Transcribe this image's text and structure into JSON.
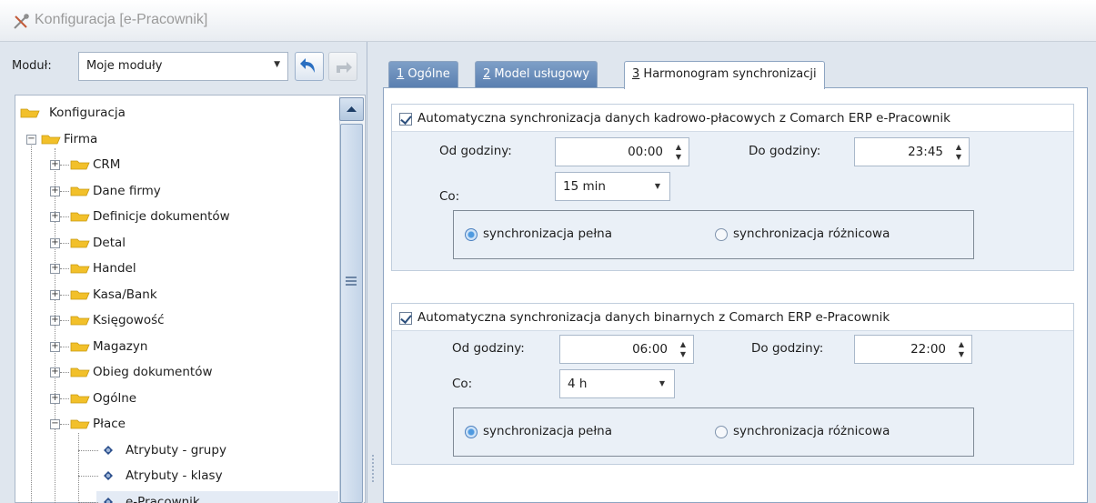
{
  "window": {
    "title": "Konfiguracja [e-Pracownik]"
  },
  "module": {
    "label": "Moduł:",
    "value": "Moje moduły"
  },
  "tree": {
    "root": "Konfiguracja",
    "firma": "Firma",
    "children": [
      "CRM",
      "Dane firmy",
      "Definicje dokumentów",
      "Detal",
      "Handel",
      "Kasa/Bank",
      "Księgowość",
      "Magazyn",
      "Obieg dokumentów",
      "Ogólne",
      "Płace"
    ],
    "place_children": [
      "Atrybuty - grupy",
      "Atrybuty - klasy",
      "e-Pracownik"
    ]
  },
  "tabs": [
    {
      "num": "1",
      "label": "Ogólne"
    },
    {
      "num": "2",
      "label": "Model usługowy"
    },
    {
      "num": "3",
      "label": "Harmonogram synchronizacji"
    }
  ],
  "groups": [
    {
      "title": "Automatyczna synchronizacja danych kadrowo-płacowych z Comarch ERP e-Pracownik",
      "from_label": "Od godziny:",
      "from_value": "00:00",
      "to_label": "Do godziny:",
      "to_value": "23:45",
      "every_label": "Co:",
      "every_value": "15 min",
      "radio_full": "synchronizacja pełna",
      "radio_diff": "synchronizacja różnicowa"
    },
    {
      "title": "Automatyczna synchronizacja danych binarnych z Comarch ERP e-Pracownik",
      "from_label": "Od godziny:",
      "from_value": "06:00",
      "to_label": "Do godziny:",
      "to_value": "22:00",
      "every_label": "Co:",
      "every_value": "4 h",
      "radio_full": "synchronizacja pełna",
      "radio_diff": "synchronizacja różnicowa"
    }
  ]
}
